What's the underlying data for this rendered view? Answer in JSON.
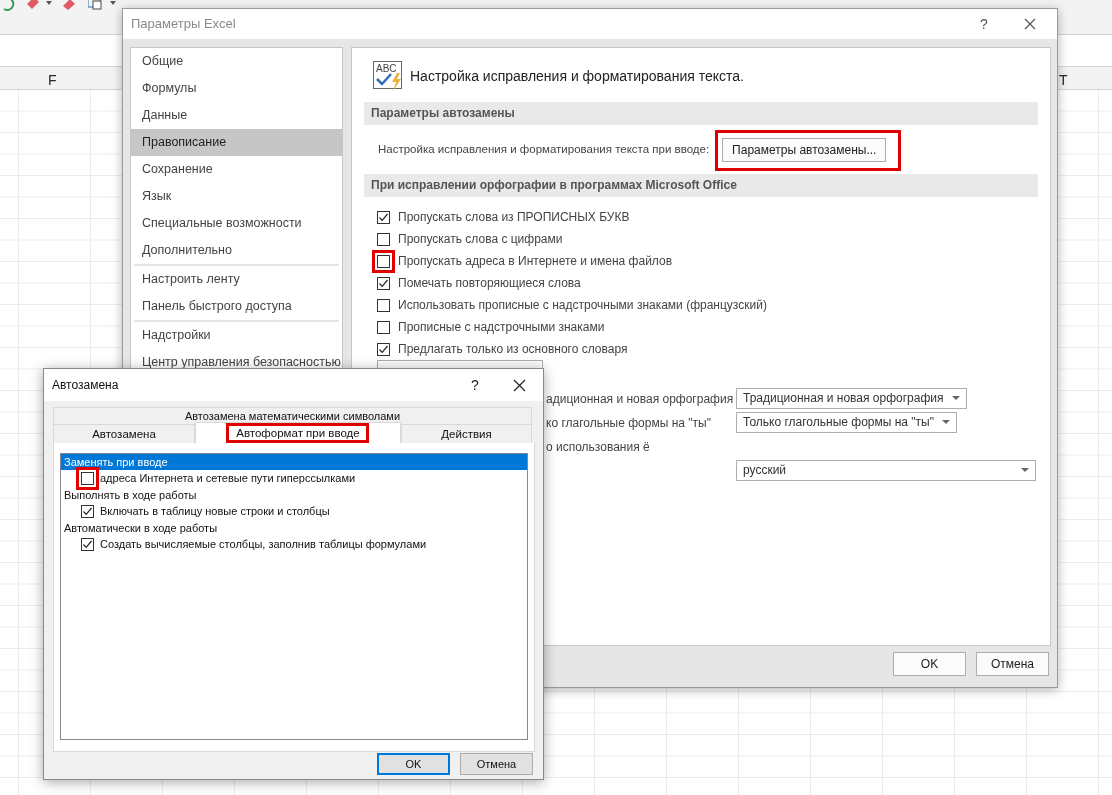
{
  "sheet": {
    "column_headers": [
      {
        "label": "F"
      },
      {
        "label": "T"
      }
    ]
  },
  "options_dialog": {
    "title": "Параметры Excel",
    "help": "?",
    "nav_groups": [
      {
        "items": [
          {
            "label": "Общие",
            "selected": false
          },
          {
            "label": "Формулы",
            "selected": false
          },
          {
            "label": "Данные",
            "selected": false
          },
          {
            "label": "Правописание",
            "selected": true
          },
          {
            "label": "Сохранение",
            "selected": false
          },
          {
            "label": "Язык",
            "selected": false
          },
          {
            "label": "Специальные возможности",
            "selected": false
          },
          {
            "label": "Дополнительно",
            "selected": false
          }
        ]
      },
      {
        "items": [
          {
            "label": "Настроить ленту",
            "selected": false
          },
          {
            "label": "Панель быстрого доступа",
            "selected": false
          }
        ]
      },
      {
        "items": [
          {
            "label": "Надстройки",
            "selected": false
          },
          {
            "label": "Центр управления безопасностью",
            "selected": false
          }
        ]
      }
    ],
    "icon_text": "ABC",
    "heading": "Настройка исправления и форматирования текста.",
    "sections": [
      {
        "title": "Параметры автозамены",
        "kind": "button_row",
        "label": "Настройка исправления и форматирования текста при вводе:",
        "button": "Параметры автозамены...",
        "highlighted": true
      },
      {
        "title": "При исправлении орфографии в программах Microsoft Office",
        "kind": "checks",
        "options": [
          {
            "label": "Пропускать слова из ПРОПИСНЫХ БУКВ",
            "checked": true
          },
          {
            "label": "Пропускать слова с цифрами",
            "checked": false
          },
          {
            "label": "Пропускать адреса в Интернете и имена файлов",
            "checked": false,
            "highlighted": true
          },
          {
            "label": "Помечать повторяющиеся слова",
            "checked": true
          },
          {
            "label": "Использовать прописные с надстрочными знаками (французский)",
            "checked": false
          },
          {
            "label": "Прописные с надстрочными знаками",
            "checked": false
          },
          {
            "label": "Предлагать только из основного словаря",
            "checked": true
          }
        ]
      }
    ],
    "partial_rows": [
      {
        "label": "адиционная и новая орфография",
        "select": "Традиционная и новая орфография"
      },
      {
        "label": "ко глагольные формы на \"ты\"",
        "select": "Только глагольные формы на \"ты\""
      },
      {
        "label": "о использования ё"
      },
      {
        "select": "русский"
      }
    ],
    "buttons": [
      "OK",
      "Отмена"
    ]
  },
  "autocorrect_dialog": {
    "title": "Автозамена",
    "help": "?",
    "tabs_top": [
      {
        "label": "Автозамена математическими символами",
        "selected": false
      }
    ],
    "tabs_bottom": [
      {
        "label": "Автозамена",
        "selected": false
      },
      {
        "label": "Автоформат при вводе",
        "selected": true,
        "highlighted": true
      },
      {
        "label": "Действия",
        "selected": false
      }
    ],
    "list": [
      {
        "kind": "group",
        "label": "Заменять при вводе",
        "selected": true
      },
      {
        "kind": "check",
        "label": "адреса Интернета и сетевые пути гиперссылками",
        "checked": false,
        "highlighted": true
      },
      {
        "kind": "group",
        "label": "Выполнять в ходе работы",
        "selected": false
      },
      {
        "kind": "check",
        "label": "Включать в таблицу новые строки и столбцы",
        "checked": true
      },
      {
        "kind": "group",
        "label": "Автоматически в ходе работы",
        "selected": false
      },
      {
        "kind": "check",
        "label": "Создать вычисляемые столбцы, заполнив таблицы формулами",
        "checked": true
      }
    ],
    "buttons": [
      {
        "label": "OK",
        "focused": true
      },
      {
        "label": "Отмена",
        "focused": false
      }
    ]
  }
}
